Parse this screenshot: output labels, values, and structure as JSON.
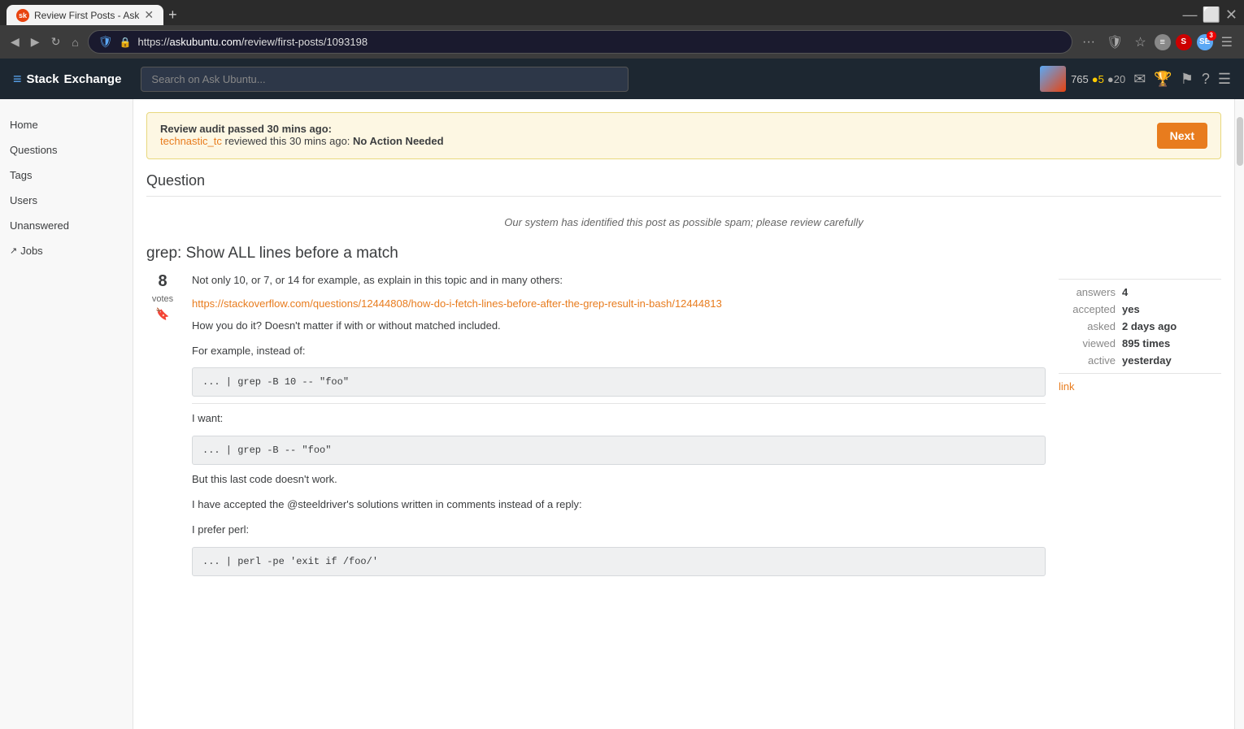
{
  "browser": {
    "tab_title": "Review First Posts - Ask",
    "favicon_text": "sk",
    "url_display": "https://askubuntu.com/review/first-posts/1093198",
    "url_domain": "askubuntu.com",
    "url_path": "/review/first-posts/1093198",
    "search_placeholder": "Search on Ask Ubuntu...",
    "new_tab_label": "+"
  },
  "header": {
    "logo_text": "Stack Exchange",
    "search_placeholder": "Search on Ask Ubuntu...",
    "user_rep": "765",
    "badge_gold_count": "5",
    "badge_silver_count": "20"
  },
  "sidebar": {
    "items": [
      {
        "label": "Home",
        "name": "home"
      },
      {
        "label": "Questions",
        "name": "questions"
      },
      {
        "label": "Tags",
        "name": "tags"
      },
      {
        "label": "Users",
        "name": "users"
      },
      {
        "label": "Unanswered",
        "name": "unanswered"
      },
      {
        "label": "Jobs",
        "name": "jobs",
        "has_ext_icon": true
      }
    ]
  },
  "audit": {
    "banner_text": "Review audit passed 30 mins ago:",
    "reviewer": "technastic_tc",
    "reviewed_text": " reviewed this 30 mins ago:",
    "action": "No Action Needed",
    "next_button": "Next"
  },
  "question": {
    "section_title": "Question",
    "spam_notice": "Our system has identified this post as possible spam; please review carefully",
    "title": "grep: Show ALL lines before a match",
    "vote_count": "8",
    "vote_label": "votes",
    "body_para1": "Not only 10, or 7, or 14 for example, as explain in this topic and in many others:",
    "link": "https://stackoverflow.com/questions/12444808/how-do-i-fetch-lines-before-after-the-grep-result-in-bash/12444813",
    "body_para2": "How you do it? Doesn't matter if with or without matched included.",
    "body_para3": "For example, instead of:",
    "code1": "... | grep -B 10 -- \"foo\"",
    "want_text": "I want:",
    "code2": "... | grep -B -- \"foo\"",
    "body_para4": "But this last code doesn't work.",
    "accepted_para": "I have accepted the @steeldriver's solutions written in comments instead of a reply:",
    "prefer_text": "I prefer perl:",
    "code3": "... | perl -pe 'exit if /foo/'"
  },
  "stats": {
    "answers_label": "answers",
    "answers_value": "4",
    "accepted_label": "accepted",
    "accepted_value": "yes",
    "asked_label": "asked",
    "asked_value": "2 days ago",
    "viewed_label": "viewed",
    "viewed_value": "895 times",
    "active_label": "active",
    "active_value": "yesterday",
    "link_text": "link"
  }
}
